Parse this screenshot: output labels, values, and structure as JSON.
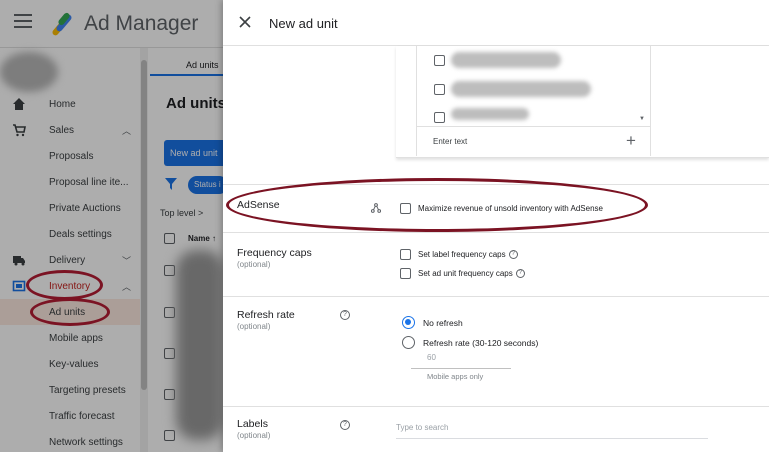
{
  "app": {
    "title": "Ad Manager"
  },
  "sidebar": {
    "items": [
      {
        "label": "Home",
        "icon": "home-icon"
      },
      {
        "label": "Sales",
        "icon": "cart-icon",
        "chevron": "^"
      },
      {
        "label": "Proposals"
      },
      {
        "label": "Proposal line ite..."
      },
      {
        "label": "Private Auctions"
      },
      {
        "label": "Deals settings"
      },
      {
        "label": "Delivery",
        "icon": "truck-icon",
        "chevron": "v"
      },
      {
        "label": "Inventory",
        "icon": "inventory-icon",
        "chevron": "^"
      },
      {
        "label": "Ad units"
      },
      {
        "label": "Mobile apps"
      },
      {
        "label": "Key-values"
      },
      {
        "label": "Targeting presets"
      },
      {
        "label": "Traffic forecast"
      },
      {
        "label": "Network settings"
      }
    ]
  },
  "main": {
    "tab": "Ad units",
    "heading": "Ad units (",
    "new_button": "New ad unit",
    "status_chip": "Status i",
    "top_level": "Top level >",
    "column_name": "Name ↑"
  },
  "panel": {
    "title": "New ad unit",
    "list": {
      "placeholder": "Enter text"
    },
    "adsense": {
      "title": "AdSense",
      "checkbox_label": "Maximize revenue of unsold inventory with AdSense"
    },
    "frequency_caps": {
      "title": "Frequency caps",
      "subtitle": "(optional)",
      "options": [
        "Set label frequency caps",
        "Set ad unit frequency caps"
      ]
    },
    "refresh_rate": {
      "title": "Refresh rate",
      "subtitle": "(optional)",
      "options": [
        "No refresh",
        "Refresh rate (30-120 seconds)"
      ],
      "selected": "No refresh",
      "input_value": "60",
      "note": "Mobile apps only"
    },
    "labels": {
      "title": "Labels",
      "subtitle": "(optional)",
      "placeholder": "Type to search"
    }
  },
  "colors": {
    "accent": "#1a73e8",
    "annotation": "#7b1323",
    "overlay": "rgba(0,0,0,0.32)"
  }
}
